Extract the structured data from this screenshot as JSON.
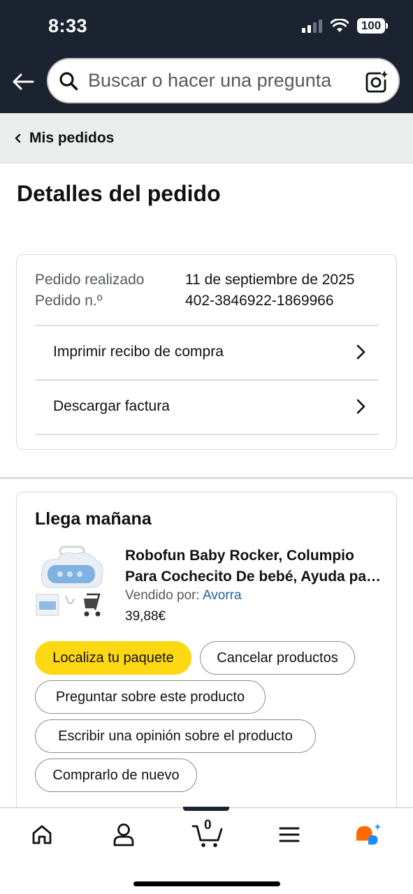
{
  "status_bar": {
    "time": "8:33",
    "battery": "100"
  },
  "search": {
    "placeholder": "Buscar o hacer una pregunta"
  },
  "breadcrumb": {
    "label": "Mis pedidos"
  },
  "page": {
    "title": "Detalles del pedido"
  },
  "order_info": {
    "placed_label": "Pedido realizado",
    "placed_value": "11 de septiembre de 2025",
    "number_label": "Pedido n.º",
    "number_value": "402-3846922-1869966",
    "links": [
      {
        "label": "Imprimir recibo de compra"
      },
      {
        "label": "Descargar factura"
      }
    ]
  },
  "shipment": {
    "heading": "Llega mañana",
    "product": {
      "title_line1": "Robofun Baby Rocker, Columpio",
      "title_line2": "Para Cochecito De bebé, Ayuda para dormir",
      "seller_label": "Vendido por:",
      "seller_name": "Avorra",
      "price": "39,88€"
    },
    "buttons": {
      "track": "Localiza tu paquete",
      "cancel": "Cancelar productos",
      "ask": "Preguntar sobre este producto",
      "review": "Escribir una opinión sobre el producto",
      "buy_again": "Comprarlo de nuevo"
    }
  },
  "bottom_nav": {
    "items": [
      "home-icon",
      "profile-icon",
      "cart-icon",
      "menu-icon",
      "rufus-icon"
    ],
    "cart_count": "0"
  },
  "colors": {
    "header_bg": "#1b2330",
    "primary_button": "#ffd814",
    "link": "#2162a1",
    "rufus_orange": "#ff6b00",
    "rufus_blue": "#1a8cff"
  }
}
